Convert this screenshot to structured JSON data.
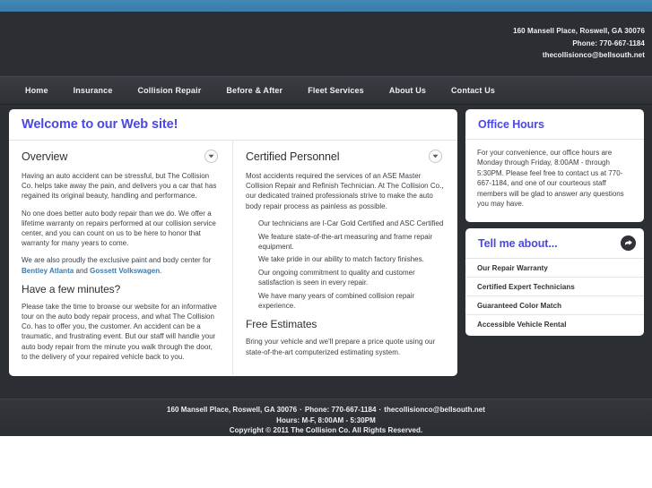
{
  "header": {
    "contact": [
      "160 Mansell Place, Roswell, GA 30076",
      "Phone: 770-667-1184",
      "thecollisionco@bellsouth.net"
    ]
  },
  "nav": {
    "items": [
      {
        "label": "Home"
      },
      {
        "label": "Insurance"
      },
      {
        "label": "Collision Repair"
      },
      {
        "label": "Before & After"
      },
      {
        "label": "Fleet Services"
      },
      {
        "label": "About Us"
      },
      {
        "label": "Contact Us"
      }
    ]
  },
  "main": {
    "welcome_title": "Welcome to our Web site!",
    "left": {
      "section_title": "Overview",
      "toggle_icon": "chevron-down-icon",
      "paragraphs": [
        "Having an auto accident can be stressful, but The Collision Co. helps take away the pain, and delivers you a car that has regained its original beauty, handling and performance.",
        "No one does better auto body repair than we do. We offer a lifetime warranty on repairs performed at our collision service center, and you can count on us to be here to honor that warranty for many years to come."
      ],
      "paint_intro": "We are also proudly the exclusive paint and body center for ",
      "link_one": "Bentley Atlanta",
      "link_joiner": " and ",
      "link_two": "Gossett Volkswagen",
      "link_end": ".",
      "sub_title": "Have a few minutes?",
      "sub_paragraph": "Please take the time to browse our website for an informative tour on the auto body repair process, and what The Collision Co. has to offer you, the customer. An accident can be a traumatic, and frustrating event. But our staff will handle your auto body repair from the minute you walk through the door, to the delivery of your repaired vehicle back to you."
    },
    "right": {
      "section_title": "Certified Personnel",
      "toggle_icon": "chevron-down-icon",
      "intro": "Most accidents required the services of an ASE Master Collision Repair and Refinish Technician. At The Collision Co., our dedicated trained professionals strive to make the auto body repair process as painless as possible.",
      "bullets": [
        "Our technicians are I-Car Gold Certified and ASC Certified",
        "We feature state-of-the-art measuring and frame repair equipment.",
        "We take pride in our ability to match factory finishes.",
        "Our ongoing commitment to quality and customer satisfaction is seen in every repair.",
        "We have many years of combined collision repair experience."
      ],
      "sub_title": "Free Estimates",
      "sub_paragraph": "Bring your vehicle and we'll prepare a price quote using our state-of-the-art computerized estimating system."
    }
  },
  "sidebar": {
    "hours": {
      "title": "Office Hours",
      "text": "For your convenience, our office hours are Monday through Friday, 8:00AM - through 5:30PM. Please feel free to contact us at 770-667-1184, and one of our courteous staff members will be glad to answer any questions you may have."
    },
    "tell": {
      "title": "Tell me about...",
      "arrow_icon": "arrow-right-icon",
      "items": [
        {
          "label": "Our Repair Warranty"
        },
        {
          "label": "Certified Expert Technicians"
        },
        {
          "label": "Guaranteed Color Match"
        },
        {
          "label": "Accessible Vehicle Rental"
        }
      ]
    }
  },
  "footer": {
    "address": "160 Mansell Place, Roswell, GA 30076",
    "sep1": "·",
    "phone": "Phone: 770-667-1184",
    "sep2": "·",
    "email": "thecollisionco@bellsouth.net",
    "hours": "Hours: M-F, 8:00AM - 5:30PM",
    "copyright": "Copyright © 2011 The Collision Co. All Rights Reserved."
  },
  "colors": {
    "banner_blue": "#3d81b0",
    "dark": "#2b2e33",
    "heading_blue": "#4a48e0",
    "link_blue": "#3a7bad"
  }
}
